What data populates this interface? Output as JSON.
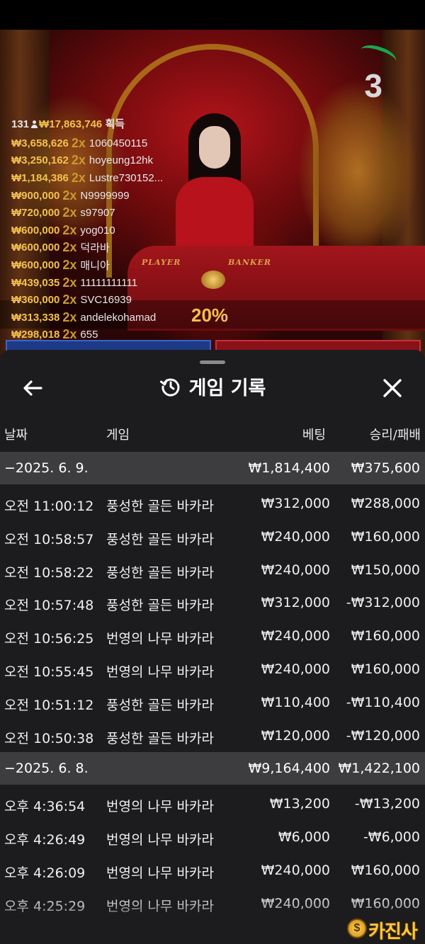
{
  "countdown": "3",
  "winners": {
    "count": "131",
    "total": "₩17,863,746",
    "suffix": "획득",
    "rows": [
      {
        "amount": "₩3,658,626",
        "mult": "2x",
        "user": "1060450115"
      },
      {
        "amount": "₩3,250,162",
        "mult": "2x",
        "user": "hoyeung12hk"
      },
      {
        "amount": "₩1,184,386",
        "mult": "2x",
        "user": "Lustre730152..."
      },
      {
        "amount": "₩900,000",
        "mult": "2x",
        "user": "N9999999"
      },
      {
        "amount": "₩720,000",
        "mult": "2x",
        "user": "s97907"
      },
      {
        "amount": "₩600,000",
        "mult": "2x",
        "user": "yog010"
      },
      {
        "amount": "₩600,000",
        "mult": "2x",
        "user": "덕라바"
      },
      {
        "amount": "₩600,000",
        "mult": "2x",
        "user": "매니아"
      },
      {
        "amount": "₩439,035",
        "mult": "2x",
        "user": "11111111111"
      },
      {
        "amount": "₩360,000",
        "mult": "2x",
        "user": "SVC16939"
      },
      {
        "amount": "₩313,338",
        "mult": "2x",
        "user": "andelekohamad"
      },
      {
        "amount": "₩298,018",
        "mult": "2x",
        "user": "655"
      }
    ]
  },
  "table": {
    "player": "PLAYER",
    "banker": "BANKER",
    "percent": "20%"
  },
  "sheet": {
    "title": "게임 기록",
    "columns": {
      "date": "날짜",
      "game": "게임",
      "bet": "베팅",
      "result": "승리/패배"
    },
    "groups": [
      {
        "date": "−2025. 6. 9.",
        "bet": "₩1,814,400",
        "result": "₩375,600",
        "rows": [
          {
            "time": "오전 11:00:12",
            "game": "풍성한 골든 바카라",
            "bet": "₩312,000",
            "result": "₩288,000"
          },
          {
            "time": "오전 10:58:57",
            "game": "풍성한 골든 바카라",
            "bet": "₩240,000",
            "result": "₩160,000"
          },
          {
            "time": "오전 10:58:22",
            "game": "풍성한 골든 바카라",
            "bet": "₩240,000",
            "result": "₩150,000"
          },
          {
            "time": "오전 10:57:48",
            "game": "풍성한 골든 바카라",
            "bet": "₩312,000",
            "result": "-₩312,000"
          },
          {
            "time": "오전 10:56:25",
            "game": "번영의 나무 바카라",
            "bet": "₩240,000",
            "result": "₩160,000"
          },
          {
            "time": "오전 10:55:45",
            "game": "번영의 나무 바카라",
            "bet": "₩240,000",
            "result": "₩160,000"
          },
          {
            "time": "오전 10:51:12",
            "game": "풍성한 골든 바카라",
            "bet": "₩110,400",
            "result": "-₩110,400"
          },
          {
            "time": "오전 10:50:38",
            "game": "풍성한 골든 바카라",
            "bet": "₩120,000",
            "result": "-₩120,000"
          }
        ]
      },
      {
        "date": "−2025. 6. 8.",
        "bet": "₩9,164,400",
        "result": "₩1,422,100",
        "rows": [
          {
            "time": "오후 4:36:54",
            "game": "번영의 나무 바카라",
            "bet": "₩13,200",
            "result": "-₩13,200"
          },
          {
            "time": "오후 4:26:49",
            "game": "번영의 나무 바카라",
            "bet": "₩6,000",
            "result": "-₩6,000"
          },
          {
            "time": "오후 4:26:09",
            "game": "번영의 나무 바카라",
            "bet": "₩240,000",
            "result": "₩160,000"
          },
          {
            "time": "오후 4:25:29",
            "game": "번영의 나무 바카라",
            "bet": "₩240,000",
            "result": "₩160,000"
          }
        ]
      }
    ]
  },
  "watermark": {
    "symbol": "$",
    "text": "카진사"
  },
  "colors": {
    "accent_gold": "#f2c14e",
    "sheet_bg": "#1c1c1e",
    "date_row_bg": "#3d3d3f",
    "timer_green": "#19a84c"
  }
}
